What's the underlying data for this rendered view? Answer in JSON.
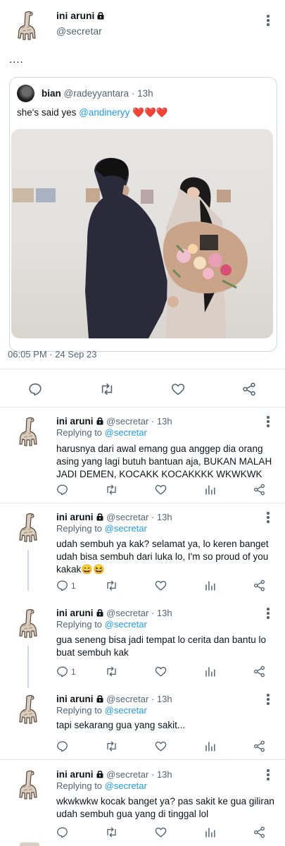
{
  "main_tweet": {
    "display_name": "ini aruni",
    "handle": "@secretar",
    "text": "....",
    "timestamp": "06:05 PM · 24 Sep 23",
    "quoted": {
      "display_name": "bian",
      "handle": "@radeyyantara",
      "time": "13h",
      "text_prefix": "she's said yes ",
      "mention": "@andineryy",
      "hearts": "❤️❤️❤️"
    }
  },
  "replies": [
    {
      "display_name": "ini aruni",
      "handle": "@secretar",
      "time": "13h",
      "replying_label": "Replying to ",
      "replying_to": "@secretar",
      "text": "harusnya dari awal emang gua anggep dia orang asing yang lagi butuh bantuan aja, BUKAN MALAH JADI DEMEN, KOCAKK KOCAKKKK WKWKWK",
      "reply_count": ""
    },
    {
      "display_name": "ini aruni",
      "handle": "@secretar",
      "time": "13h",
      "replying_label": "Replying to ",
      "replying_to": "@secretar",
      "text": "udah sembuh ya kak? selamat ya, lo keren banget udah bisa sembuh dari luka lo, I'm so proud of you kakak😄😆",
      "reply_count": "1"
    },
    {
      "display_name": "ini aruni",
      "handle": "@secretar",
      "time": "13h",
      "replying_label": "Replying to ",
      "replying_to": "@secretar",
      "text": "gua seneng bisa jadi tempat lo cerita dan bantu lo buat sembuh kak",
      "reply_count": "1"
    },
    {
      "display_name": "ini aruni",
      "handle": "@secretar",
      "time": "13h",
      "replying_label": "Replying to ",
      "replying_to": "@secretar",
      "text": "tapi sekarang gua yang sakit...",
      "reply_count": ""
    },
    {
      "display_name": "ini aruni",
      "handle": "@secretar",
      "time": "13h",
      "replying_label": "Replying to ",
      "replying_to": "@secretar",
      "text": "wkwkwkw kocak banget ya? pas sakit ke gua giliran udah sembuh gua yang di tinggal lol",
      "reply_count": ""
    }
  ],
  "separator": "·",
  "colors": {
    "link": "#1d9bf0",
    "muted": "#536471",
    "divider": "#e6e9eb"
  },
  "icons": [
    "lock-icon",
    "more-icon",
    "reply-icon",
    "retweet-icon",
    "like-icon",
    "views-icon",
    "share-icon"
  ]
}
